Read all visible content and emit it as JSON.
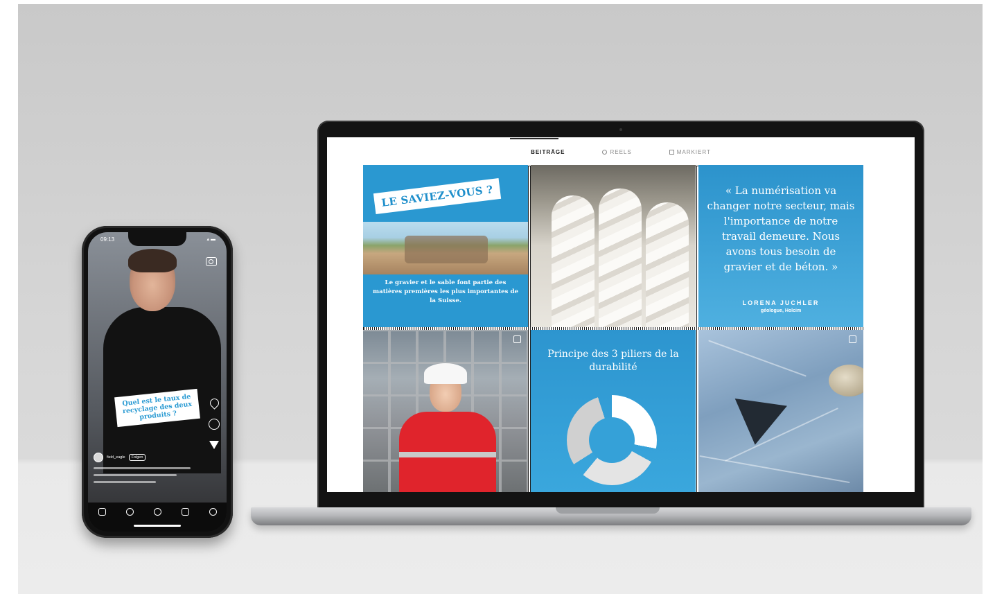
{
  "phone": {
    "status_time": "09:13",
    "status_icons": "▴ ▬",
    "question_sticker": "Quel est le taux de recyclage des deux produits ?",
    "reel": {
      "username": "field_eagle",
      "follow_label": "Folgen"
    },
    "nav_icons": [
      "home-icon",
      "search-icon",
      "add-icon",
      "reels-icon",
      "profile-icon"
    ]
  },
  "laptop": {
    "tabs": [
      {
        "label": "BEITRÄGE",
        "icon": "grid-icon",
        "active": true
      },
      {
        "label": "REELS",
        "icon": "reels-icon",
        "active": false
      },
      {
        "label": "MARKIERT",
        "icon": "tagged-icon",
        "active": false
      }
    ],
    "posts": {
      "p1": {
        "badge": "LE SAVIEZ-VOUS ?",
        "text": "Le gravier et le sable font partie des matières premières les plus importantes de la Suisse."
      },
      "p3": {
        "quote": "« La numérisation va changer notre secteur, mais l'importance de notre travail demeure. Nous avons tous besoin de gravier et de béton. »",
        "author": "LORENA JUCHLER",
        "role": "géologue, Holcim"
      },
      "p5": {
        "title": "Principe des 3 piliers de la durabilité"
      }
    }
  },
  "colors": {
    "brand_blue": "#2b9bd3",
    "jacket_red": "#e0242c"
  }
}
